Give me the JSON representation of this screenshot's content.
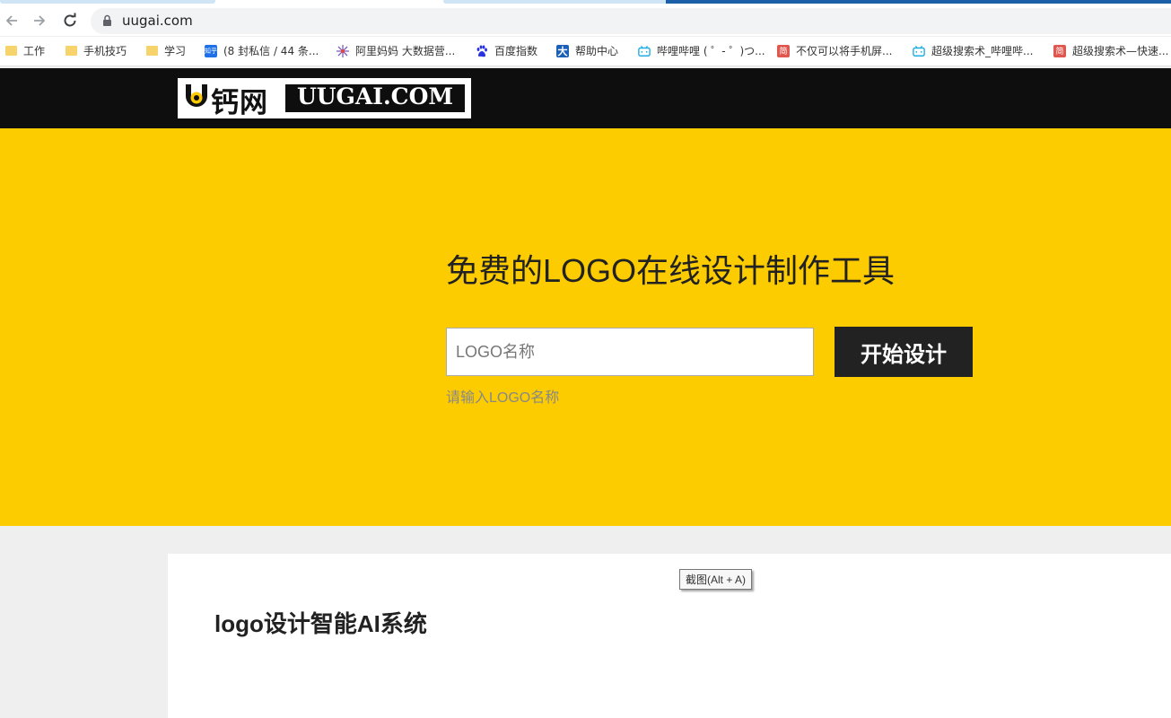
{
  "browser": {
    "url": "uugai.com",
    "bookmarks": [
      {
        "label": "工作",
        "icon": "folder-icon"
      },
      {
        "label": "手机技巧",
        "icon": "folder-icon"
      },
      {
        "label": "学习",
        "icon": "folder-icon"
      },
      {
        "label": "(8 封私信 / 44 条...",
        "icon": "zhihu-icon",
        "icon_text": "知乎"
      },
      {
        "label": "阿里妈妈 大数据营...",
        "icon": "alimama-icon"
      },
      {
        "label": "百度指数",
        "icon": "baidu-paw-icon"
      },
      {
        "label": "帮助中心",
        "icon": "da-icon",
        "icon_text": "大"
      },
      {
        "label": "哔哩哔哩 ( ゜- ゜)つ...",
        "icon": "bilibili-icon"
      },
      {
        "label": "不仅可以将手机屏...",
        "icon": "jianshu-icon",
        "icon_text": "简"
      },
      {
        "label": "超级搜索术_哔哩哔...",
        "icon": "bilibili-icon"
      },
      {
        "label": "超级搜索术—快速...",
        "icon": "jianshu-icon",
        "icon_text": "简"
      }
    ]
  },
  "header": {
    "logo_cn": "钙网",
    "logo_en": "UUGAI.COM"
  },
  "hero": {
    "title": "免费的LOGO在线设计制作工具",
    "input_placeholder": "LOGO名称",
    "button_label": "开始设计",
    "hint": "请输入LOGO名称"
  },
  "content": {
    "section_title": "logo设计智能AI系统"
  },
  "tooltip": "截图(Alt + A)",
  "colors": {
    "hero_bg": "#fccb00",
    "header_bg": "#0e0e0e",
    "button_bg": "#222222"
  }
}
